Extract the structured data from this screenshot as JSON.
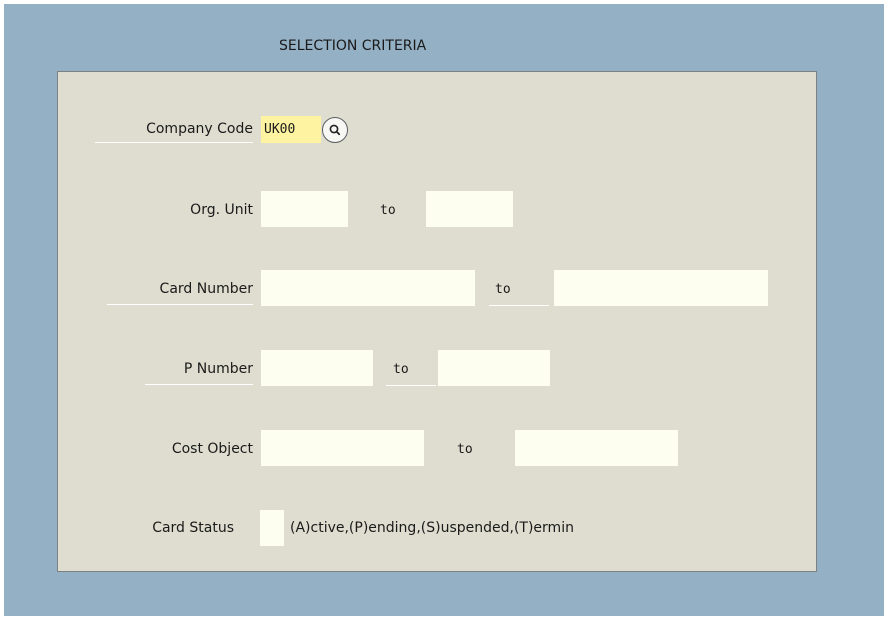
{
  "group": {
    "title": "SELECTION CRITERIA"
  },
  "fields": {
    "company_code": {
      "label": "Company Code",
      "value": "UK00"
    },
    "org_unit": {
      "label": "Org. Unit",
      "from": "",
      "to_label": "to",
      "to": ""
    },
    "card_number": {
      "label": "Card Number",
      "from": "",
      "to_label": "to",
      "to": ""
    },
    "p_number": {
      "label": "P Number",
      "from": "",
      "to_label": "to",
      "to": ""
    },
    "cost_object": {
      "label": "Cost Object",
      "from": "",
      "to_label": "to",
      "to": ""
    },
    "card_status": {
      "label": "Card Status",
      "value": "",
      "description": "(A)ctive,(P)ending,(S)uspended,(T)ermin"
    }
  },
  "icons": {
    "value_help": "search-icon"
  },
  "colors": {
    "screen_background": "#94b0c4",
    "group_background": "#deddcf",
    "input_background": "#fefef0",
    "required_input_background": "#fef3a0"
  }
}
